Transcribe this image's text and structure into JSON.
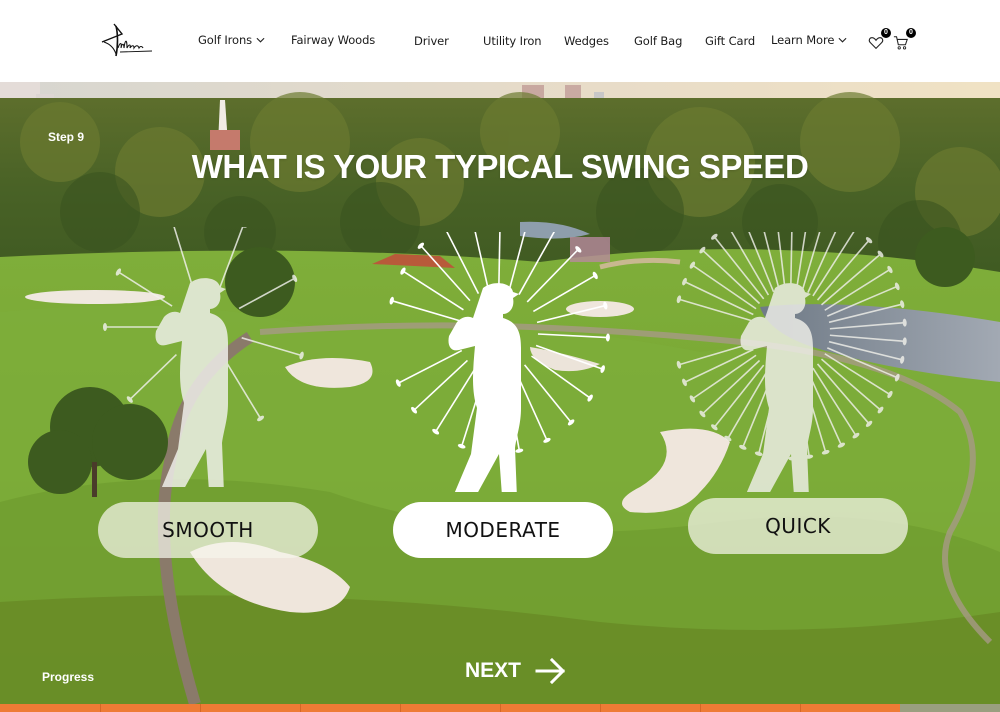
{
  "header": {
    "logo_alt": "Takomo",
    "nav": [
      {
        "label": "Golf Irons",
        "has_dropdown": true
      },
      {
        "label": "Fairway Woods",
        "has_dropdown": false
      },
      {
        "label": "Driver",
        "has_dropdown": false
      },
      {
        "label": "Utility Iron",
        "has_dropdown": false
      },
      {
        "label": "Wedges",
        "has_dropdown": false
      },
      {
        "label": "Golf Bag",
        "has_dropdown": false
      },
      {
        "label": "Gift Card",
        "has_dropdown": false
      },
      {
        "label": "Learn More",
        "has_dropdown": true
      }
    ],
    "wishlist": {
      "icon": "heart-icon",
      "count": "0"
    },
    "cart": {
      "icon": "cart-icon",
      "count": "0"
    }
  },
  "quiz": {
    "step_label": "Step 9",
    "title": "WHAT IS YOUR TYPICAL SWING SPEED",
    "options": [
      {
        "label": "SMOOTH",
        "selected": false,
        "icon": "golfer-slow-swing-icon"
      },
      {
        "label": "MODERATE",
        "selected": true,
        "icon": "golfer-moderate-swing-icon"
      },
      {
        "label": "QUICK",
        "selected": false,
        "icon": "golfer-fast-swing-icon"
      }
    ],
    "progress_label": "Progress",
    "progress_percent": 90,
    "progress_segments": 10,
    "next_label": "NEXT"
  },
  "colors": {
    "accent": "#ee7b35",
    "progress_track": "#9a9f80",
    "header_bg": "#ffffff",
    "text_dark": "#111111"
  }
}
